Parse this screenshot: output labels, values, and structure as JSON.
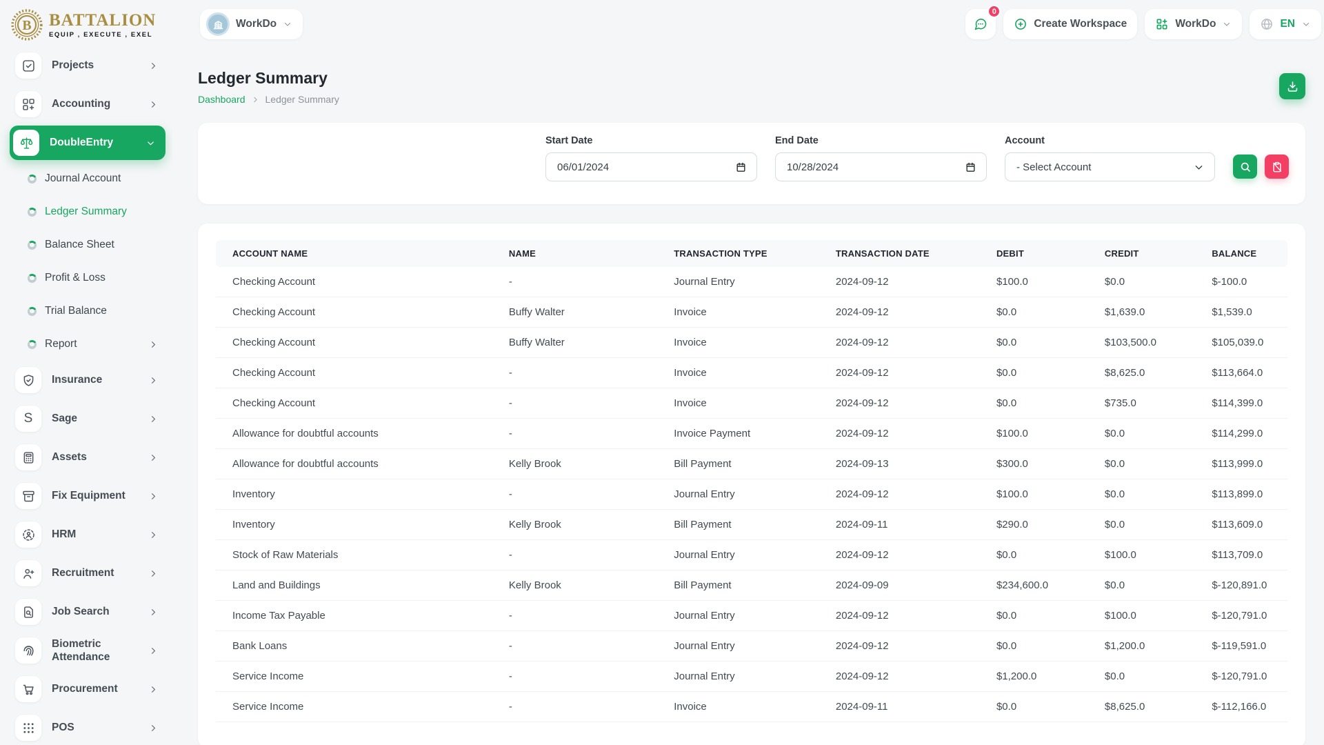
{
  "brand": {
    "name": "BATTALION",
    "tagline": "EQUIP , EXECUTE , EXEL",
    "monogram": "B"
  },
  "colors": {
    "accent_green": "#17a760",
    "danger_pink": "#f43f65",
    "logo_gold": "#a98e41",
    "avatar_blue": "#a5c7da"
  },
  "topbar": {
    "workspace_switcher": {
      "label": "WorkDo",
      "icon": "building-icon"
    },
    "messages": {
      "icon": "chat-icon",
      "badge": "0"
    },
    "create_workspace": {
      "label": "Create Workspace",
      "icon": "plus-circle-icon"
    },
    "app_menu": {
      "label": "WorkDo",
      "icon": "grid-plus-icon"
    },
    "language": {
      "label": "EN",
      "icon": "globe-icon"
    }
  },
  "sidebar": {
    "items": [
      {
        "label": "Projects",
        "icon": "projects-icon",
        "chevron": "right"
      },
      {
        "label": "Accounting",
        "icon": "accounting-icon",
        "chevron": "right"
      },
      {
        "label": "DoubleEntry",
        "icon": "double-entry-scales-icon",
        "chevron": "down",
        "active": true
      },
      {
        "label": "Journal Account",
        "sub": true
      },
      {
        "label": "Ledger Summary",
        "sub": true,
        "active": true
      },
      {
        "label": "Balance Sheet",
        "sub": true
      },
      {
        "label": "Profit & Loss",
        "sub": true
      },
      {
        "label": "Trial Balance",
        "sub": true
      },
      {
        "label": "Report",
        "sub": true,
        "chevron": "right"
      },
      {
        "label": "Insurance",
        "icon": "insurance-icon",
        "chevron": "right"
      },
      {
        "label": "Sage",
        "icon": "sage-icon",
        "chevron": "right"
      },
      {
        "label": "Assets",
        "icon": "assets-icon",
        "chevron": "right"
      },
      {
        "label": "Fix Equipment",
        "icon": "fix-equipment-icon",
        "chevron": "right"
      },
      {
        "label": "HRM",
        "icon": "hrm-icon",
        "chevron": "right"
      },
      {
        "label": "Recruitment",
        "icon": "recruitment-icon",
        "chevron": "right"
      },
      {
        "label": "Job Search",
        "icon": "job-search-icon",
        "chevron": "right"
      },
      {
        "label": "Biometric Attendance",
        "icon": "biometric-attendance-icon",
        "chevron": "right"
      },
      {
        "label": "Procurement",
        "icon": "procurement-icon",
        "chevron": "right"
      },
      {
        "label": "POS",
        "icon": "pos-icon",
        "chevron": "right"
      }
    ]
  },
  "page": {
    "title": "Ledger Summary",
    "breadcrumb": [
      "Dashboard",
      "Ledger Summary"
    ]
  },
  "filters": {
    "start_date": {
      "label": "Start Date",
      "value": "06/01/2024"
    },
    "end_date": {
      "label": "End Date",
      "value": "10/28/2024"
    },
    "account": {
      "label": "Account",
      "value": "- Select Account"
    }
  },
  "table": {
    "columns": [
      "ACCOUNT NAME",
      "NAME",
      "TRANSACTION TYPE",
      "TRANSACTION DATE",
      "DEBIT",
      "CREDIT",
      "BALANCE"
    ],
    "rows": [
      [
        "Checking Account",
        "-",
        "Journal Entry",
        "2024-09-12",
        "$100.0",
        "$0.0",
        "$-100.0"
      ],
      [
        "Checking Account",
        "Buffy Walter",
        "Invoice",
        "2024-09-12",
        "$0.0",
        "$1,639.0",
        "$1,539.0"
      ],
      [
        "Checking Account",
        "Buffy Walter",
        "Invoice",
        "2024-09-12",
        "$0.0",
        "$103,500.0",
        "$105,039.0"
      ],
      [
        "Checking Account",
        "-",
        "Invoice",
        "2024-09-12",
        "$0.0",
        "$8,625.0",
        "$113,664.0"
      ],
      [
        "Checking Account",
        "-",
        "Invoice",
        "2024-09-12",
        "$0.0",
        "$735.0",
        "$114,399.0"
      ],
      [
        "Allowance for doubtful accounts",
        "-",
        "Invoice Payment",
        "2024-09-12",
        "$100.0",
        "$0.0",
        "$114,299.0"
      ],
      [
        "Allowance for doubtful accounts",
        "Kelly Brook",
        "Bill Payment",
        "2024-09-13",
        "$300.0",
        "$0.0",
        "$113,999.0"
      ],
      [
        "Inventory",
        "-",
        "Journal Entry",
        "2024-09-12",
        "$100.0",
        "$0.0",
        "$113,899.0"
      ],
      [
        "Inventory",
        "Kelly Brook",
        "Bill Payment",
        "2024-09-11",
        "$290.0",
        "$0.0",
        "$113,609.0"
      ],
      [
        "Stock of Raw Materials",
        "-",
        "Journal Entry",
        "2024-09-12",
        "$0.0",
        "$100.0",
        "$113,709.0"
      ],
      [
        "Land and Buildings",
        "Kelly Brook",
        "Bill Payment",
        "2024-09-09",
        "$234,600.0",
        "$0.0",
        "$-120,891.0"
      ],
      [
        "Income Tax Payable",
        "-",
        "Journal Entry",
        "2024-09-12",
        "$0.0",
        "$100.0",
        "$-120,791.0"
      ],
      [
        "Bank Loans",
        "-",
        "Journal Entry",
        "2024-09-12",
        "$0.0",
        "$1,200.0",
        "$-119,591.0"
      ],
      [
        "Service Income",
        "-",
        "Journal Entry",
        "2024-09-12",
        "$1,200.0",
        "$0.0",
        "$-120,791.0"
      ],
      [
        "Service Income",
        "-",
        "Invoice",
        "2024-09-11",
        "$0.0",
        "$8,625.0",
        "$-112,166.0"
      ]
    ]
  }
}
